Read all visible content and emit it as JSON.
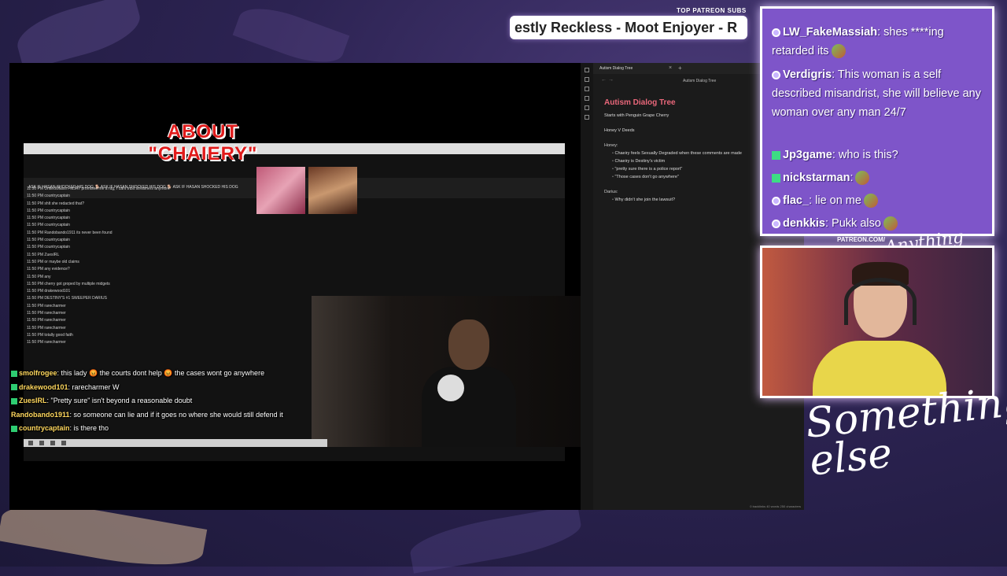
{
  "colors": {
    "accent_purple": "#7e55c9",
    "notes_heading": "#e9677a",
    "about_red": "#e01b1b"
  },
  "banner": {
    "top_patreon_label": "TOP PATREON SUBS",
    "ticker_text": "estly Reckless - Moot Enjoyer - R"
  },
  "stream": {
    "about_title": "ABOUT \"CHAIERY\"",
    "inner_browser": {
      "header_line": "ASK IF HASAN SHOCKED HIS DOG 🐕 ASK IF HASAN SHOCKED HIS DOG 🐕 ASK IF HASAN SHOCKED HIS DOG",
      "chat_lines": [
        "11:50 PM  UnitedGlassi FMJAY promised me a rug, I cant trust streamers anymore",
        "11:50 PM  countrycaptain",
        "11:50 PM  shlt she redacted that?",
        "11:50 PM  countrycaptain",
        "11:50 PM  countrycaptain",
        "11:50 PM  countrycaptain",
        "11:50 PM  Randobando1911 its never been found",
        "11:50 PM  countrycaptain",
        "11:50 PM  countrycaptain",
        "11:50 PM  ZuesIRL",
        "11:50 PM  or maybe old claims",
        "11:50 PM  any evidence?",
        "11:50 PM  any",
        "11:50 PM  cherry got groped by multiple midgets",
        "11:50 PM  drakewood101",
        "11:50 PM  DESTINY'S #1 SWEEPER DARIUS",
        "11:50 PM  rarecharmer",
        "11:50 PM  rarecharmer",
        "11:50 PM  rarecharmer",
        "11:50 PM  rarecharmer",
        "11:50 PM  totally good faith",
        "11:50 PM  rarecharmer"
      ]
    },
    "overlay_chat": [
      {
        "user": "smolfrogee",
        "text": ": this lady 😡 the courts dont help 😡 the cases wont go anywhere"
      },
      {
        "user": "drakewood101",
        "text": ": rarecharmer W"
      },
      {
        "user": "ZuesIRL",
        "text": ": \"Pretty sure\" isn't beyond a reasonable doubt"
      },
      {
        "user": "Randobando1911",
        "text": ": so someone can lie and if it goes no where she would still defend it"
      },
      {
        "user": "countrycaptain",
        "text": ": is there tho"
      }
    ]
  },
  "notes": {
    "tab_label": "Autism Dialog Tree",
    "breadcrumb": "Autism Dialog Tree",
    "heading": "Autism Dialog Tree",
    "line1": "Starts with Penguin Grape Cherry",
    "line2": "Honey V Deeds",
    "honey_label": "Honey:",
    "honey_items": [
      "Chaeiry feels Sexually Degraded when these comments are made",
      "Chaeiry is Destiny's victim",
      "\"pretty sure there is a police report\"",
      "\"Those cases don't go anywhere\""
    ],
    "darius_label": "Darius:",
    "darius_items": [
      "Why didn't she join the lawsuit?"
    ],
    "status": "0 backlinks   40 words  250 characters"
  },
  "chat": {
    "lines": [
      {
        "user": "LW_FakeMassiah",
        "text": ": shes ****ing retarded its",
        "icon": "twitch-icon"
      },
      {
        "user": "Verdigris",
        "text": ": This woman is a self described misandrist, she will believe any woman over any man 24/7",
        "icon": "twitch-icon"
      },
      {
        "user": "Jp3game",
        "text": ": who is this?",
        "icon": "k-icon"
      },
      {
        "user": "nickstarman",
        "text": ":",
        "icon": "k-icon"
      },
      {
        "user": "flac_",
        "text": ": lie on me",
        "icon": "twitch-icon"
      },
      {
        "user": "denkkis",
        "text": ": Pukk also",
        "icon": "twitch-icon"
      }
    ]
  },
  "branding": {
    "patreon_url": "PATREON.COM/",
    "anything_else": "Anything Else",
    "signature": "Something else"
  }
}
